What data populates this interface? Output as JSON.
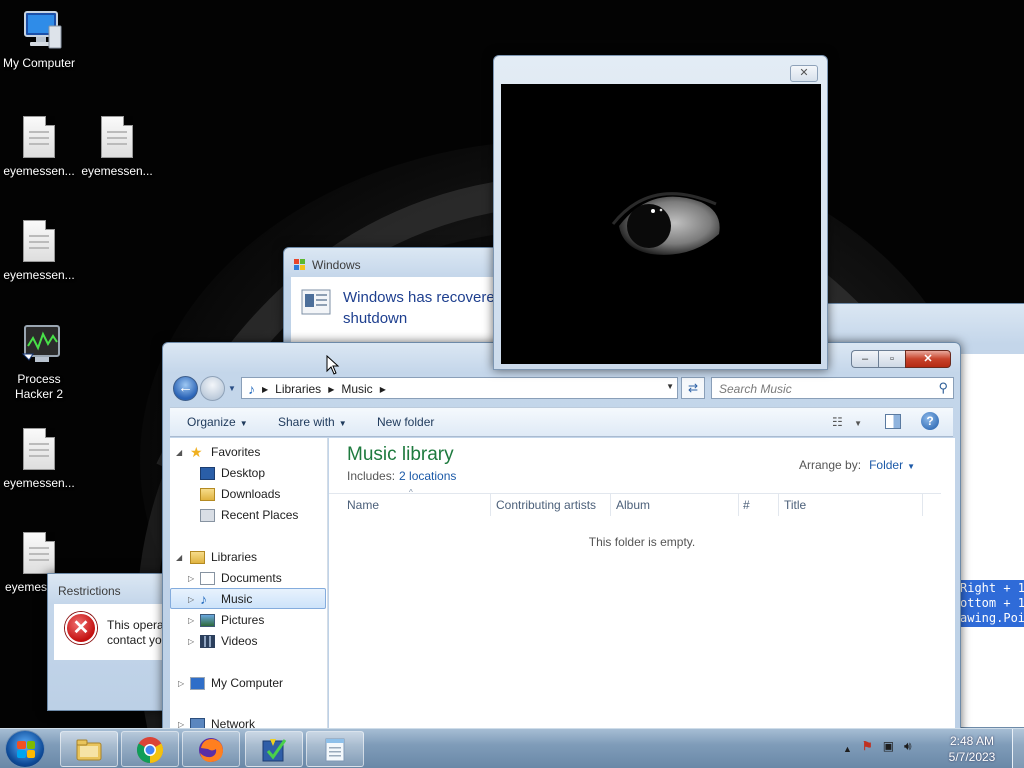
{
  "desktop": {
    "icons": [
      {
        "label": "My Computer",
        "type": "computer"
      },
      {
        "label": "eyemessen...",
        "type": "document"
      },
      {
        "label": "eyemessen...",
        "type": "document"
      },
      {
        "label": "eyemessen...",
        "type": "document"
      },
      {
        "label": "Process Hacker 2",
        "type": "process-hacker"
      },
      {
        "label": "eyemessen...",
        "type": "document"
      },
      {
        "label": "eyemes",
        "type": "document"
      }
    ]
  },
  "windows_dialog": {
    "title": "Windows",
    "message": "Windows has recovere shutdown"
  },
  "restrictions_dialog": {
    "title": "Restrictions",
    "line1": "This opera",
    "line2": "contact yo"
  },
  "eye_window": {
    "close_glyph": "✕"
  },
  "code_snippet": {
    "line1": "Right + 1",
    "line2": "ottom + 1",
    "line3": "awing.Poi"
  },
  "explorer": {
    "caption": {
      "minimize": "–",
      "maximize": "▫",
      "close": "✕"
    },
    "breadcrumb": [
      "Libraries",
      "Music"
    ],
    "search_placeholder": "Search Music",
    "commands": {
      "organize": "Organize",
      "share_with": "Share with",
      "new_folder": "New folder"
    },
    "nav": {
      "favorites": "Favorites",
      "desktop": "Desktop",
      "downloads": "Downloads",
      "recent_places": "Recent Places",
      "libraries": "Libraries",
      "documents": "Documents",
      "music": "Music",
      "pictures": "Pictures",
      "videos": "Videos",
      "my_computer": "My Computer",
      "network": "Network"
    },
    "library_title": "Music library",
    "includes_label": "Includes:",
    "includes_link": "2 locations",
    "arrange_by_label": "Arrange by:",
    "arrange_by_value": "Folder",
    "columns": [
      "Name",
      "Contributing artists",
      "Album",
      "#",
      "Title"
    ],
    "empty_message": "This folder is empty."
  },
  "taskbar": {
    "pinned": [
      "Windows Explorer",
      "Google Chrome",
      "Firefox",
      "Program",
      "Notepad"
    ],
    "clock_time": "2:48 AM",
    "clock_date": "5/7/2023"
  }
}
